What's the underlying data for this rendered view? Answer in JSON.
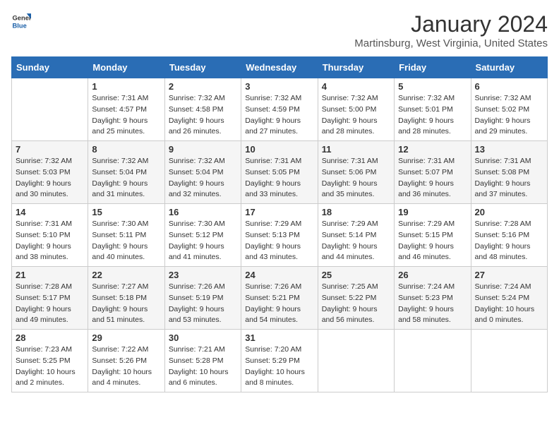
{
  "header": {
    "logo_general": "General",
    "logo_blue": "Blue",
    "month": "January 2024",
    "location": "Martinsburg, West Virginia, United States"
  },
  "days_of_week": [
    "Sunday",
    "Monday",
    "Tuesday",
    "Wednesday",
    "Thursday",
    "Friday",
    "Saturday"
  ],
  "weeks": [
    [
      {
        "day": "",
        "sunrise": "",
        "sunset": "",
        "daylight": ""
      },
      {
        "day": "1",
        "sunrise": "Sunrise: 7:31 AM",
        "sunset": "Sunset: 4:57 PM",
        "daylight": "Daylight: 9 hours and 25 minutes."
      },
      {
        "day": "2",
        "sunrise": "Sunrise: 7:32 AM",
        "sunset": "Sunset: 4:58 PM",
        "daylight": "Daylight: 9 hours and 26 minutes."
      },
      {
        "day": "3",
        "sunrise": "Sunrise: 7:32 AM",
        "sunset": "Sunset: 4:59 PM",
        "daylight": "Daylight: 9 hours and 27 minutes."
      },
      {
        "day": "4",
        "sunrise": "Sunrise: 7:32 AM",
        "sunset": "Sunset: 5:00 PM",
        "daylight": "Daylight: 9 hours and 28 minutes."
      },
      {
        "day": "5",
        "sunrise": "Sunrise: 7:32 AM",
        "sunset": "Sunset: 5:01 PM",
        "daylight": "Daylight: 9 hours and 28 minutes."
      },
      {
        "day": "6",
        "sunrise": "Sunrise: 7:32 AM",
        "sunset": "Sunset: 5:02 PM",
        "daylight": "Daylight: 9 hours and 29 minutes."
      }
    ],
    [
      {
        "day": "7",
        "sunrise": "Sunrise: 7:32 AM",
        "sunset": "Sunset: 5:03 PM",
        "daylight": "Daylight: 9 hours and 30 minutes."
      },
      {
        "day": "8",
        "sunrise": "Sunrise: 7:32 AM",
        "sunset": "Sunset: 5:04 PM",
        "daylight": "Daylight: 9 hours and 31 minutes."
      },
      {
        "day": "9",
        "sunrise": "Sunrise: 7:32 AM",
        "sunset": "Sunset: 5:04 PM",
        "daylight": "Daylight: 9 hours and 32 minutes."
      },
      {
        "day": "10",
        "sunrise": "Sunrise: 7:31 AM",
        "sunset": "Sunset: 5:05 PM",
        "daylight": "Daylight: 9 hours and 33 minutes."
      },
      {
        "day": "11",
        "sunrise": "Sunrise: 7:31 AM",
        "sunset": "Sunset: 5:06 PM",
        "daylight": "Daylight: 9 hours and 35 minutes."
      },
      {
        "day": "12",
        "sunrise": "Sunrise: 7:31 AM",
        "sunset": "Sunset: 5:07 PM",
        "daylight": "Daylight: 9 hours and 36 minutes."
      },
      {
        "day": "13",
        "sunrise": "Sunrise: 7:31 AM",
        "sunset": "Sunset: 5:08 PM",
        "daylight": "Daylight: 9 hours and 37 minutes."
      }
    ],
    [
      {
        "day": "14",
        "sunrise": "Sunrise: 7:31 AM",
        "sunset": "Sunset: 5:10 PM",
        "daylight": "Daylight: 9 hours and 38 minutes."
      },
      {
        "day": "15",
        "sunrise": "Sunrise: 7:30 AM",
        "sunset": "Sunset: 5:11 PM",
        "daylight": "Daylight: 9 hours and 40 minutes."
      },
      {
        "day": "16",
        "sunrise": "Sunrise: 7:30 AM",
        "sunset": "Sunset: 5:12 PM",
        "daylight": "Daylight: 9 hours and 41 minutes."
      },
      {
        "day": "17",
        "sunrise": "Sunrise: 7:29 AM",
        "sunset": "Sunset: 5:13 PM",
        "daylight": "Daylight: 9 hours and 43 minutes."
      },
      {
        "day": "18",
        "sunrise": "Sunrise: 7:29 AM",
        "sunset": "Sunset: 5:14 PM",
        "daylight": "Daylight: 9 hours and 44 minutes."
      },
      {
        "day": "19",
        "sunrise": "Sunrise: 7:29 AM",
        "sunset": "Sunset: 5:15 PM",
        "daylight": "Daylight: 9 hours and 46 minutes."
      },
      {
        "day": "20",
        "sunrise": "Sunrise: 7:28 AM",
        "sunset": "Sunset: 5:16 PM",
        "daylight": "Daylight: 9 hours and 48 minutes."
      }
    ],
    [
      {
        "day": "21",
        "sunrise": "Sunrise: 7:28 AM",
        "sunset": "Sunset: 5:17 PM",
        "daylight": "Daylight: 9 hours and 49 minutes."
      },
      {
        "day": "22",
        "sunrise": "Sunrise: 7:27 AM",
        "sunset": "Sunset: 5:18 PM",
        "daylight": "Daylight: 9 hours and 51 minutes."
      },
      {
        "day": "23",
        "sunrise": "Sunrise: 7:26 AM",
        "sunset": "Sunset: 5:19 PM",
        "daylight": "Daylight: 9 hours and 53 minutes."
      },
      {
        "day": "24",
        "sunrise": "Sunrise: 7:26 AM",
        "sunset": "Sunset: 5:21 PM",
        "daylight": "Daylight: 9 hours and 54 minutes."
      },
      {
        "day": "25",
        "sunrise": "Sunrise: 7:25 AM",
        "sunset": "Sunset: 5:22 PM",
        "daylight": "Daylight: 9 hours and 56 minutes."
      },
      {
        "day": "26",
        "sunrise": "Sunrise: 7:24 AM",
        "sunset": "Sunset: 5:23 PM",
        "daylight": "Daylight: 9 hours and 58 minutes."
      },
      {
        "day": "27",
        "sunrise": "Sunrise: 7:24 AM",
        "sunset": "Sunset: 5:24 PM",
        "daylight": "Daylight: 10 hours and 0 minutes."
      }
    ],
    [
      {
        "day": "28",
        "sunrise": "Sunrise: 7:23 AM",
        "sunset": "Sunset: 5:25 PM",
        "daylight": "Daylight: 10 hours and 2 minutes."
      },
      {
        "day": "29",
        "sunrise": "Sunrise: 7:22 AM",
        "sunset": "Sunset: 5:26 PM",
        "daylight": "Daylight: 10 hours and 4 minutes."
      },
      {
        "day": "30",
        "sunrise": "Sunrise: 7:21 AM",
        "sunset": "Sunset: 5:28 PM",
        "daylight": "Daylight: 10 hours and 6 minutes."
      },
      {
        "day": "31",
        "sunrise": "Sunrise: 7:20 AM",
        "sunset": "Sunset: 5:29 PM",
        "daylight": "Daylight: 10 hours and 8 minutes."
      },
      {
        "day": "",
        "sunrise": "",
        "sunset": "",
        "daylight": ""
      },
      {
        "day": "",
        "sunrise": "",
        "sunset": "",
        "daylight": ""
      },
      {
        "day": "",
        "sunrise": "",
        "sunset": "",
        "daylight": ""
      }
    ]
  ]
}
